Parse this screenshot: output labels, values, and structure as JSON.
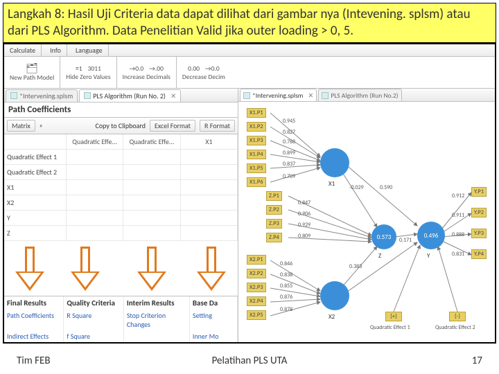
{
  "instruction": "Langkah 8: Hasil Uji Criteria data dapat dilihat dari gambar nya (Intevening. splsm) atau dari PLS Algorithm. Data Penelitian Valid jika outer loading > 0, 5.",
  "menubar": [
    "Calculate",
    "Info",
    "Language"
  ],
  "toolbar": {
    "newmodel": {
      "label": "New Path Model",
      "glyph": "🗂"
    },
    "hidezero": {
      "label": "Hide Zero Values",
      "glyph1": "≡1",
      "glyph2": "3011"
    },
    "incdec": {
      "label": "Increase Decimals",
      "glyph1": "→0.0",
      "glyph2": "→.00"
    },
    "decdec": {
      "label": "Decrease Decim",
      "glyph1": "0.00",
      "glyph2": "→0.0"
    }
  },
  "left_tabs": {
    "t1": "*Intervening.splsm",
    "t2": "PLS Algorithm (Run No. 2)"
  },
  "section_title": "Path Coefficients",
  "subtoolbar": {
    "matrix": "Matrix",
    "copy": "Copy to Clipboard",
    "excel": "Excel Format",
    "r": "R Format"
  },
  "grid": {
    "cols": [
      "",
      "Quadratic Effe...",
      "Quadratic Effe...",
      "X1"
    ],
    "rows": [
      "Quadratic Effect 1",
      "Quadratic Effect 2",
      "X1",
      "X2",
      "Y",
      "Z"
    ]
  },
  "results": {
    "headers": [
      "Final Results",
      "Quality Criteria",
      "Interim Results",
      "Base Da"
    ],
    "r1": [
      "Path Coefficients",
      "R Square",
      "Stop Criterion Changes",
      "Setting"
    ],
    "r2": [
      "Indirect Effects",
      "f Square",
      "",
      "Inner Mo"
    ]
  },
  "right_tabs": {
    "t1": "*Intervening.splsm",
    "t2": "PLS Algorithm (Run No.2)"
  },
  "indicators": {
    "x": [
      "X1.P1",
      "X1.P2",
      "X1.P3",
      "X1.P4",
      "X1.P5",
      "X1.P6"
    ],
    "z": [
      "Z.P1",
      "Z.P2",
      "Z.P3",
      "Z.P4"
    ],
    "x2": [
      "X2.P1",
      "X2.P2",
      "X2.P3",
      "X2.P4",
      "X2.P5"
    ],
    "y": [
      "Y.P1",
      "Y.P2",
      "Y.P3",
      "Y.P4"
    ],
    "q": [
      "[+]",
      "[-]"
    ]
  },
  "lv": {
    "x1": "X1",
    "x2": "X2",
    "z": "Z",
    "y": "Y"
  },
  "qlabels": {
    "q1": "Quadratic Effect 1",
    "q2": "Quadratic Effect 2"
  },
  "loadings": {
    "x": [
      "0.945",
      "0.827",
      "0.788",
      "0.899",
      "0.837",
      "0.709"
    ],
    "z": [
      "0.847",
      "0.906",
      "0.929",
      "0.809"
    ],
    "x2": [
      "0.846",
      "0.838",
      "0.855",
      "0.876",
      "0.878"
    ],
    "y": [
      "0.912",
      "0.911",
      "0.888",
      "0.831"
    ],
    "paths": {
      "x1z": "-0.029",
      "x1y": "0.590",
      "zt": "0.573",
      "x2z": "0.383",
      "zy": "0.171",
      "x2y": "0.496"
    }
  },
  "footer": {
    "left": "Tim FEB",
    "center": "Pelatihan PLS UTA",
    "page": "17"
  }
}
